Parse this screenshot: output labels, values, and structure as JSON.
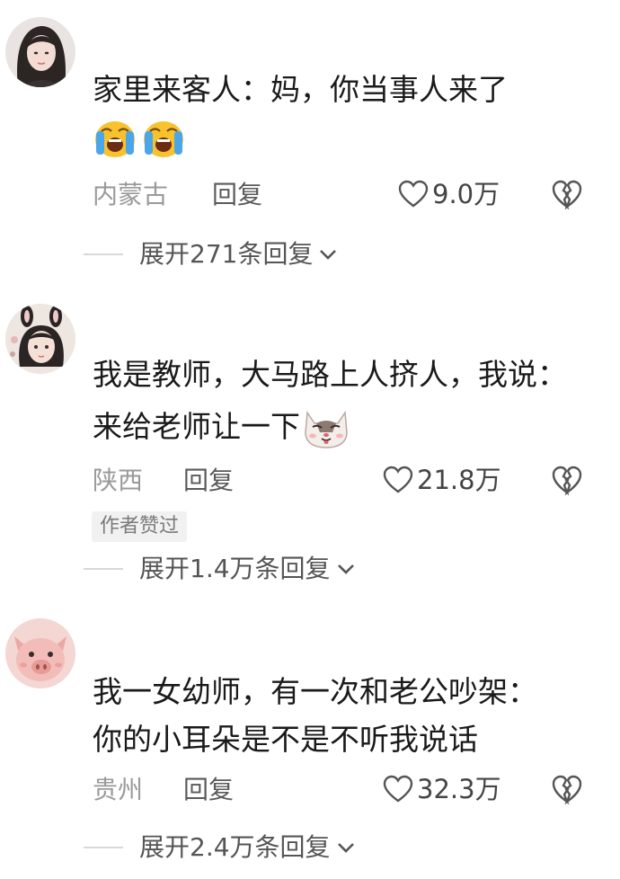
{
  "comments": [
    {
      "text_lines": [
        "家里来客人：妈，你当事人来了"
      ],
      "emojis": [
        "loudly-crying-face-icon",
        "loudly-crying-face-icon"
      ],
      "location": "内蒙古",
      "reply_label": "回复",
      "likes": "9.0万",
      "expand_label": "展开271条回复"
    },
    {
      "text_lines": [
        "我是教师，大马路上人挤人，我说：",
        "来给老师让一下"
      ],
      "emojis": [
        "cat-face-icon"
      ],
      "location": "陕西",
      "reply_label": "回复",
      "likes": "21.8万",
      "badge": "作者赞过",
      "expand_label": "展开1.4万条回复"
    },
    {
      "text_lines": [
        "我一女幼师，有一次和老公吵架：",
        "你的小耳朵是不是不听我说话"
      ],
      "location": "贵州",
      "reply_label": "回复",
      "likes": "32.3万",
      "expand_label": "展开2.4万条回复"
    }
  ],
  "colors": {
    "text": "#1a1a1a",
    "meta": "#9a9a9a",
    "divider": "#d8d8d8",
    "badge_bg": "#f1f1f1"
  }
}
